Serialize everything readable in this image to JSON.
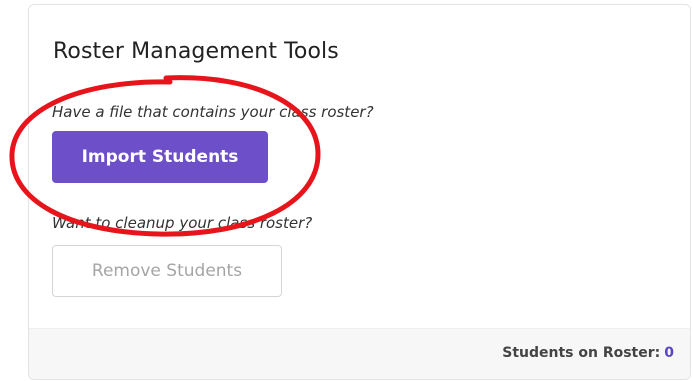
{
  "panel": {
    "title": "Roster Management Tools",
    "import_prompt": "Have a file that contains your class roster?",
    "import_button_label": "Import Students",
    "remove_prompt": "Want to cleanup your class roster?",
    "remove_button_label": "Remove Students"
  },
  "footer": {
    "students_label": "Students on Roster:",
    "students_count": "0"
  },
  "colors": {
    "primary": "#6c4fc9",
    "annotation": "#e8141c",
    "count_accent": "#5a46c5"
  }
}
